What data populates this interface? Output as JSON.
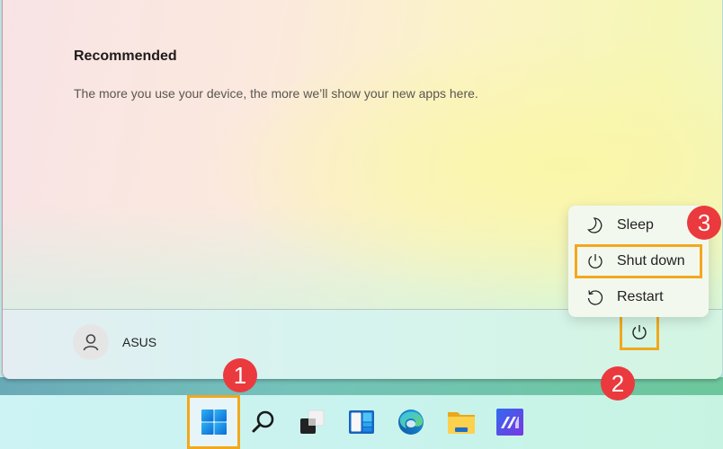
{
  "start_menu": {
    "recommended": {
      "title": "Recommended",
      "description": "The more you use your device, the more we’ll show your new apps here."
    },
    "user": {
      "name": "ASUS",
      "icon": "user-icon"
    },
    "power_button": {
      "icon": "power-icon"
    },
    "power_menu": {
      "items": [
        {
          "label": "Sleep",
          "icon": "moon-icon"
        },
        {
          "label": "Shut down",
          "icon": "power-icon",
          "highlighted": true
        },
        {
          "label": "Restart",
          "icon": "restart-icon"
        }
      ]
    }
  },
  "taskbar": {
    "items": [
      {
        "name": "Start",
        "icon": "windows-logo-icon",
        "highlighted": true
      },
      {
        "name": "Search",
        "icon": "search-icon"
      },
      {
        "name": "Task View",
        "icon": "task-view-icon"
      },
      {
        "name": "Widgets",
        "icon": "widgets-icon"
      },
      {
        "name": "Microsoft Edge",
        "icon": "edge-icon"
      },
      {
        "name": "File Explorer",
        "icon": "folder-icon"
      },
      {
        "name": "MyASUS",
        "icon": "myasus-icon"
      }
    ]
  },
  "annotations": {
    "step1": "1",
    "step2": "2",
    "step3": "3",
    "highlight_color": "#f2a81d",
    "badge_color": "#ea3a3e"
  }
}
